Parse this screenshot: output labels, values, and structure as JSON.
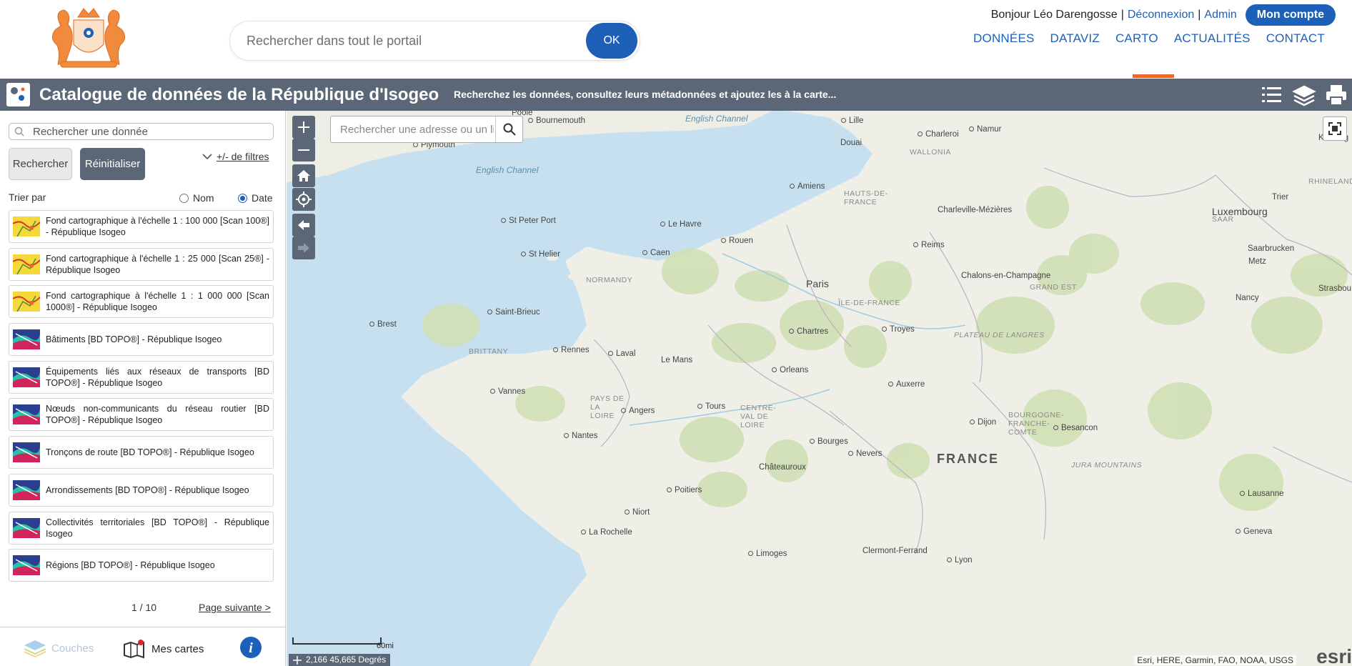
{
  "header": {
    "search_placeholder": "Rechercher dans tout le portail",
    "ok_label": "OK",
    "greeting": "Bonjour Léo Darengosse",
    "separator": "|",
    "logout": "Déconnexion",
    "admin": "Admin",
    "account": "Mon compte",
    "nav": [
      "DONNÉES",
      "DATAVIZ",
      "CARTO",
      "ACTUALITÉS",
      "CONTACT"
    ],
    "active_nav": "CARTO",
    "accent_color": "#e8692a",
    "brand_color": "#1d60b8"
  },
  "titlebar": {
    "title": "Catalogue de données de la République d'Isogeo",
    "subtitle": "Recherchez les données, consultez leurs métadonnées et ajoutez les à la carte...",
    "tools": [
      "list-icon",
      "layers-icon",
      "print-icon"
    ],
    "bg_color": "#5b6776"
  },
  "panel": {
    "search_placeholder": "Rechercher une donnée",
    "search_button": "Rechercher",
    "reset_button": "Réinitialiser",
    "filters_link": "+/- de filtres",
    "sort_label": "Trier par",
    "sort_options": [
      "Nom",
      "Date"
    ],
    "sort_selected": "Date",
    "items": [
      {
        "title": "Fond cartographique à l'échelle 1 : 100 000 [Scan 100®] - République Isogeo",
        "thumb": "scan-map-thumbnail"
      },
      {
        "title": "Fond cartographique à l'échelle 1 : 25 000 [Scan 25®] - République Isogeo",
        "thumb": "scan-map-thumbnail"
      },
      {
        "title": "Fond cartographique à l'échelle 1 : 1 000 000 [Scan 1000®] - République Isogeo",
        "thumb": "scan-map-thumbnail"
      },
      {
        "title": "Bâtiments [BD TOPO®] - République Isogeo",
        "thumb": "vector-thumbnail"
      },
      {
        "title": "Équipements liés aux réseaux de transports [BD TOPO®] - République Isogeo",
        "thumb": "vector-thumbnail"
      },
      {
        "title": "Nœuds non-communicants du réseau routier [BD TOPO®] - République Isogeo",
        "thumb": "vector-thumbnail"
      },
      {
        "title": "Tronçons de route [BD TOPO®] - République Isogeo",
        "thumb": "vector-thumbnail"
      },
      {
        "title": "Arrondissements [BD TOPO®] - République Isogeo",
        "thumb": "vector-thumbnail"
      },
      {
        "title": "Collectivités territoriales [BD TOPO®] - République Isogeo",
        "thumb": "vector-thumbnail"
      },
      {
        "title": "Régions [BD TOPO®] - République Isogeo",
        "thumb": "vector-thumbnail"
      }
    ],
    "pager_count": "1 / 10",
    "pager_next": "Page suivante >",
    "bottom": {
      "layers": "Couches",
      "my_maps": "Mes cartes"
    }
  },
  "map": {
    "search_placeholder": "Rechercher une adresse ou un li",
    "scale_label": "60mi",
    "coords": "2,166 45,665 Degrés",
    "attribution": "Esri, HERE, Garmin, FAO, NOAA, USGS",
    "esri_logo": "esri",
    "labels": {
      "cities": [
        "Poole",
        "Bournemouth",
        "Plymouth",
        "St Peter Port",
        "St Helier",
        "Le Havre",
        "Rouen",
        "Caen",
        "Amiens",
        "Lille",
        "Douai",
        "Charleroi",
        "Namur",
        "Kobleng",
        "Luxembourg",
        "Trier",
        "Charleville-Mézières",
        "Reims",
        "Metz",
        "Saarbrucken",
        "Chalons-en-Champagne",
        "Nancy",
        "Paris",
        "Chartres",
        "Saint-Brieuc",
        "Brest",
        "Rennes",
        "Laval",
        "Le Mans",
        "Orleans",
        "Auxerre",
        "Troyes",
        "Strasbou",
        "Vannes",
        "Angers",
        "Tours",
        "Nantes",
        "Bourges",
        "Nevers",
        "Dijon",
        "Besancon",
        "Châteauroux",
        "Poitiers",
        "Niort",
        "La Rochelle",
        "Limoges",
        "Clermont-Ferrand",
        "Lyon",
        "Lausanne",
        "Geneva"
      ],
      "regions": [
        "NORMANDY",
        "BRITTANY",
        "HAUTS-DE-FRANCE",
        "ÎLE-DE-FRANCE",
        "GRAND EST",
        "PAYS DE LA LOIRE",
        "CENTRE-VAL DE LOIRE",
        "BOURGOGNE-FRANCHE-COMTE",
        "WALLONIA",
        "PLATEAU DE LANGRES",
        "JURA MOUNTAINS",
        "SAAR",
        "RHINELAND-PALATINA"
      ],
      "seas": [
        "English Channel",
        "English Channel"
      ],
      "country": "FRANCE"
    }
  }
}
